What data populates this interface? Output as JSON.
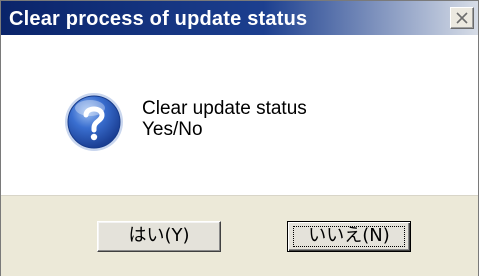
{
  "dialog": {
    "title": "Clear process of update status",
    "message_line1": "Clear update status",
    "message_line2": "Yes/No",
    "icon": "question-icon",
    "close_icon": "close-icon"
  },
  "buttons": {
    "yes_label": "はい(Y)",
    "no_label": "いいえ(N)"
  },
  "colors": {
    "titlebar_start": "#0a246a",
    "titlebar_end": "#d7dde7",
    "button_bar": "#ece9d8"
  }
}
